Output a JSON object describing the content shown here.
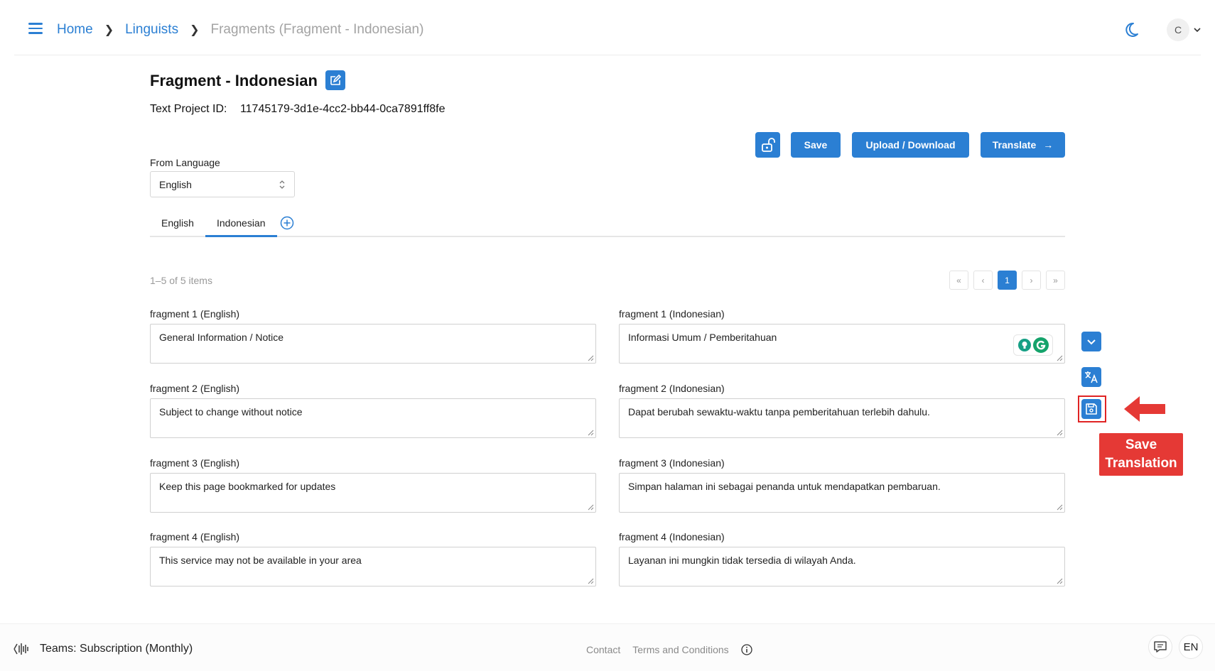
{
  "header": {
    "breadcrumbs": [
      "Home",
      "Linguists"
    ],
    "current": "Fragments (Fragment - Indonesian)",
    "avatar_initial": "C"
  },
  "page": {
    "title": "Fragment - Indonesian",
    "project_label": "Text Project ID:",
    "project_id": "11745179-3d1e-4cc2-bb44-0ca7891ff8fe"
  },
  "actions": {
    "save": "Save",
    "upload": "Upload / Download",
    "translate": "Translate"
  },
  "from_language": {
    "label": "From Language",
    "value": "English"
  },
  "tabs": [
    "English",
    "Indonesian"
  ],
  "list": {
    "count": "1–5 of 5 items",
    "current_page": "1"
  },
  "fragments": [
    {
      "en_label": "fragment 1 (English)",
      "en_text": "General Information / Notice",
      "id_label": "fragment 1 (Indonesian)",
      "id_text": "Informasi Umum / Pemberitahuan"
    },
    {
      "en_label": "fragment 2 (English)",
      "en_text": "Subject to change without notice",
      "id_label": "fragment 2 (Indonesian)",
      "id_text": "Dapat berubah sewaktu-waktu tanpa pemberitahuan terlebih dahulu."
    },
    {
      "en_label": "fragment 3 (English)",
      "en_text": "Keep this page bookmarked for updates",
      "id_label": "fragment 3 (Indonesian)",
      "id_text": "Simpan halaman ini sebagai penanda untuk mendapatkan pembaruan."
    },
    {
      "en_label": "fragment 4 (English)",
      "en_text": "This service may not be available in your area",
      "id_label": "fragment 4 (Indonesian)",
      "id_text": "Layanan ini mungkin tidak tersedia di wilayah Anda."
    }
  ],
  "annotation": {
    "line1": "Save",
    "line2": "Translation"
  },
  "footer": {
    "team": "Teams: Subscription (Monthly)",
    "contact": "Contact",
    "terms": "Terms and Conditions",
    "lang": "EN"
  },
  "colors": {
    "accent": "#2b7fd3",
    "highlight": "#e02424"
  }
}
